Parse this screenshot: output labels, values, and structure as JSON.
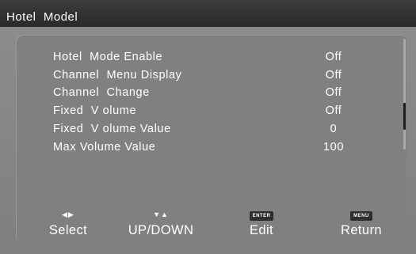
{
  "window": {
    "title": "Hotel  Model"
  },
  "menu": {
    "items": [
      {
        "label": "Hotel  Mode Enable",
        "value": "Off"
      },
      {
        "label": "Channel  Menu Display",
        "value": "Off"
      },
      {
        "label": "Channel  Change",
        "value": "Off"
      },
      {
        "label": "Fixed  V olume",
        "value": "Off"
      },
      {
        "label": "Fixed  V olume Value",
        "value": "0"
      },
      {
        "label": "Max Volume Value",
        "value": "100"
      }
    ]
  },
  "scrollbar": {
    "position_fraction": 0.76
  },
  "footer": {
    "select": {
      "icon": "left-right-arrows-icon",
      "glyph": "◀▶",
      "label": "Select"
    },
    "updown": {
      "icon": "down-up-arrows-icon",
      "glyph": "▼▲",
      "label": "UP/DOWN"
    },
    "edit": {
      "icon": "enter-key-icon",
      "key": "ENTER",
      "label": "Edit"
    },
    "return": {
      "icon": "menu-key-icon",
      "key": "MENU",
      "label": "Return"
    }
  }
}
